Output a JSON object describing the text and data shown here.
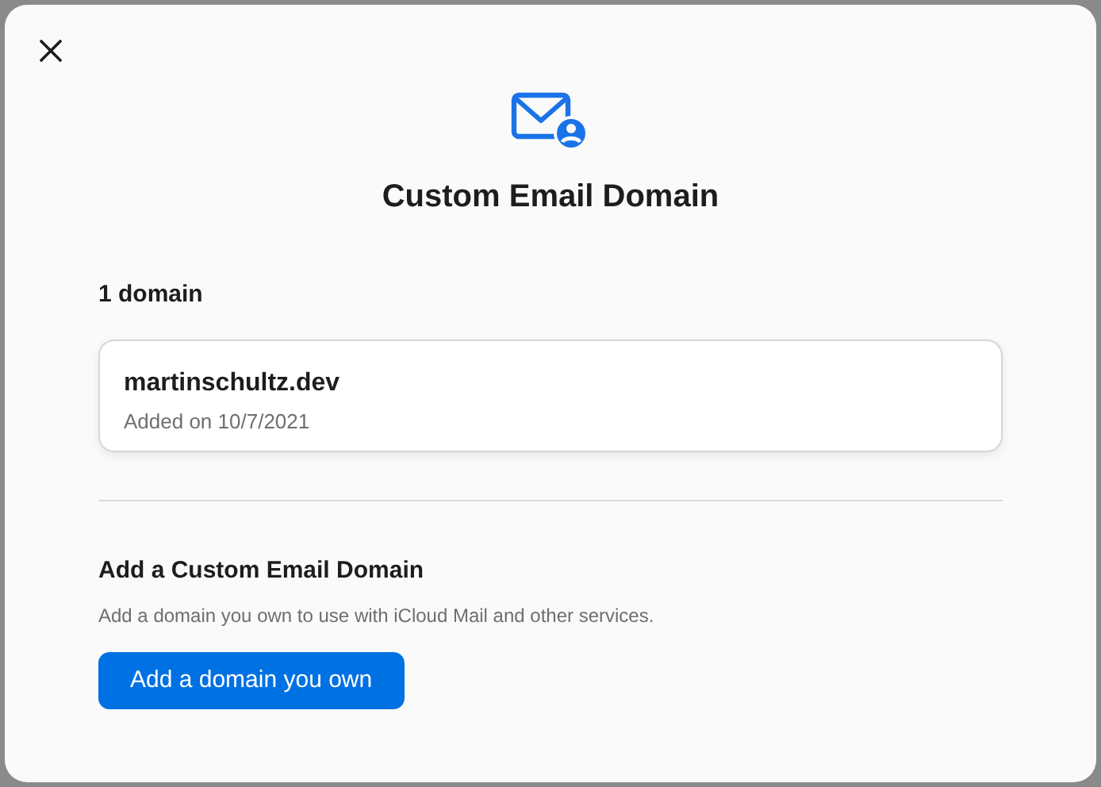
{
  "dialog": {
    "title": "Custom Email Domain",
    "domains_heading": "1 domain",
    "domains": [
      {
        "name": "martinschultz.dev",
        "added": "Added on 10/7/2021"
      }
    ],
    "add_section": {
      "heading": "Add a Custom Email Domain",
      "description": "Add a domain you own to use with iCloud Mail and other services.",
      "button": "Add a domain you own"
    }
  }
}
